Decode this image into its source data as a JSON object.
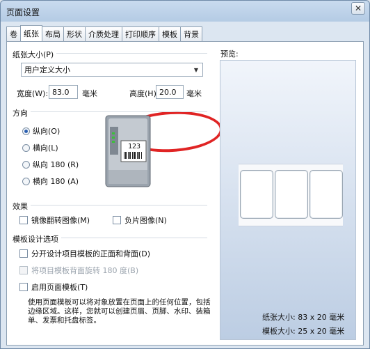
{
  "window": {
    "title": "页面设置",
    "close_glyph": "✕"
  },
  "tabs": [
    "卷",
    "纸张",
    "布局",
    "形状",
    "介质处理",
    "打印顺序",
    "模板",
    "背景"
  ],
  "active_tab": "纸张",
  "paper_size": {
    "group_label": "纸张大小(P)",
    "selected": "用户定义大小",
    "width_label": "宽度(W):",
    "width_value": "83.0",
    "width_unit": "毫米",
    "height_label": "高度(H):",
    "height_value": "20.0",
    "height_unit": "毫米"
  },
  "orientation": {
    "group_label": "方向",
    "options": [
      "纵向(O)",
      "横向(L)",
      "纵向 180 (R)",
      "横向 180 (A)"
    ],
    "selected_index": 0
  },
  "printer_sample_text": "123",
  "effects": {
    "group_label": "效果",
    "mirror": "镜像翻转图像(M)",
    "negative": "负片图像(N)"
  },
  "template_design": {
    "group_label": "模板设计选项",
    "split_front_back": "分开设计项目模板的正面和背面(D)",
    "rotate_back": "将项目模板背面旋转 180 度(B)",
    "enable_page_template": "启用页面模板(T)",
    "hint": "使用页面模板可以将对象放置在页面上的任何位置，包括边缘区域。这样，您就可以创建页眉、页脚、水印、装箱单、发票和托盘标签。"
  },
  "preview": {
    "label": "预览:",
    "paper_size_text": "纸张大小: 83 x 20 毫米",
    "template_size_text": "模板大小: 25 x 20 毫米"
  },
  "colors": {
    "annotation_oval": "#e02424",
    "accent": "#2b5fb0"
  }
}
